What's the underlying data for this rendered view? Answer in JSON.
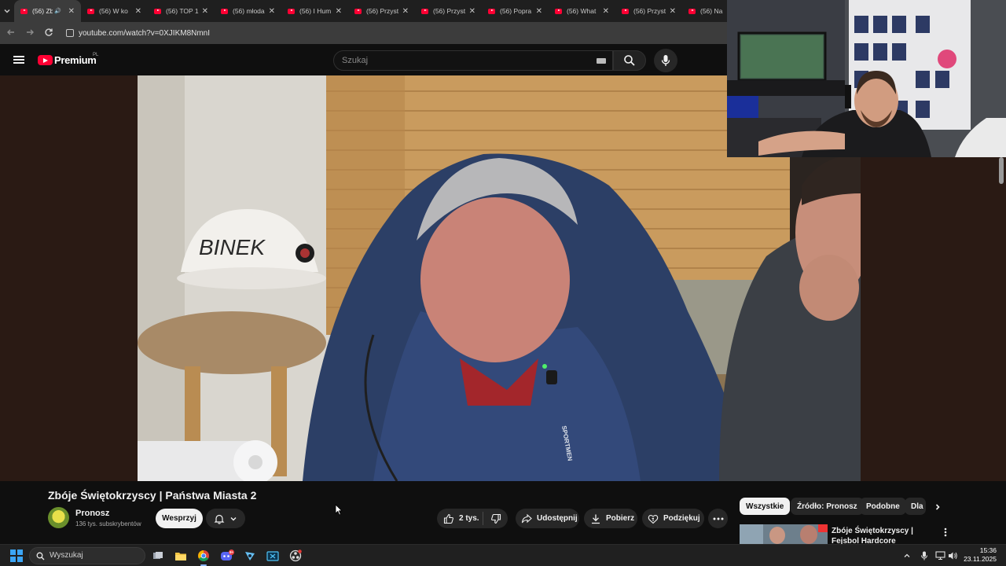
{
  "browser": {
    "tabs": [
      {
        "label": "(56) Zb",
        "active": true,
        "audio": true
      },
      {
        "label": "(56) W ko"
      },
      {
        "label": "(56) TOP 1"
      },
      {
        "label": "(56) młoda"
      },
      {
        "label": "(56) I Hum"
      },
      {
        "label": "(56) Przyst"
      },
      {
        "label": "(56) Przyst"
      },
      {
        "label": "(56) Popra"
      },
      {
        "label": "(56) What"
      },
      {
        "label": "(56) Przyst"
      },
      {
        "label": "(56) Na"
      }
    ],
    "url": "youtube.com/watch?v=0XJIKM8NmnI"
  },
  "youtube": {
    "brand": "Premium",
    "region": "PL",
    "search_placeholder": "Szukaj"
  },
  "video": {
    "title": "Zbóje Świętokrzyscy | Państwa Miasta 2",
    "helmet_text": "BINEK",
    "jacket_text": "SPORTMEN"
  },
  "channel": {
    "name": "Pronosz",
    "subscribers": "136 tys. subskrybentów",
    "support_label": "Wesprzyj"
  },
  "actions": {
    "likes": "2 tys.",
    "share": "Udostępnij",
    "download": "Pobierz",
    "thanks": "Podziękuj"
  },
  "chips": [
    "Wszystkie",
    "Źródło: Pronosz",
    "Podobne",
    "Dla"
  ],
  "recommendation": {
    "title": "Zbóje Świętokrzyscy | Fejsbol Hardcore"
  },
  "taskbar": {
    "search": "Wyszukaj",
    "time": "15:36",
    "date": "23.11.2025",
    "discord_badge": "9+"
  },
  "colors": {
    "yt_red": "#ff0033",
    "background": "#0f0f0f",
    "chip_active": "#f1f1f1",
    "taskbar": "#202020"
  }
}
